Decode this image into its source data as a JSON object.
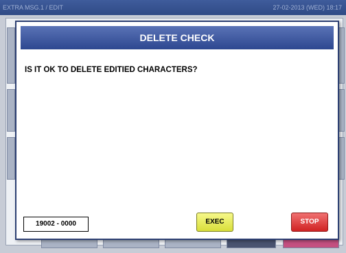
{
  "header": {
    "left_title": "EXTRA MSG.1 / EDIT",
    "datetime": "27-02-2013 (WED) 18:17"
  },
  "dialog": {
    "title": "DELETE CHECK",
    "message": "IS IT OK TO DELETE EDITIED CHARACTERS?",
    "code": "19002 - 0000",
    "exec_label": "EXEC",
    "stop_label": "STOP"
  },
  "colors": {
    "title_bar": "#2d4790",
    "exec_button": "#e6ea5a",
    "stop_button": "#e04040"
  }
}
